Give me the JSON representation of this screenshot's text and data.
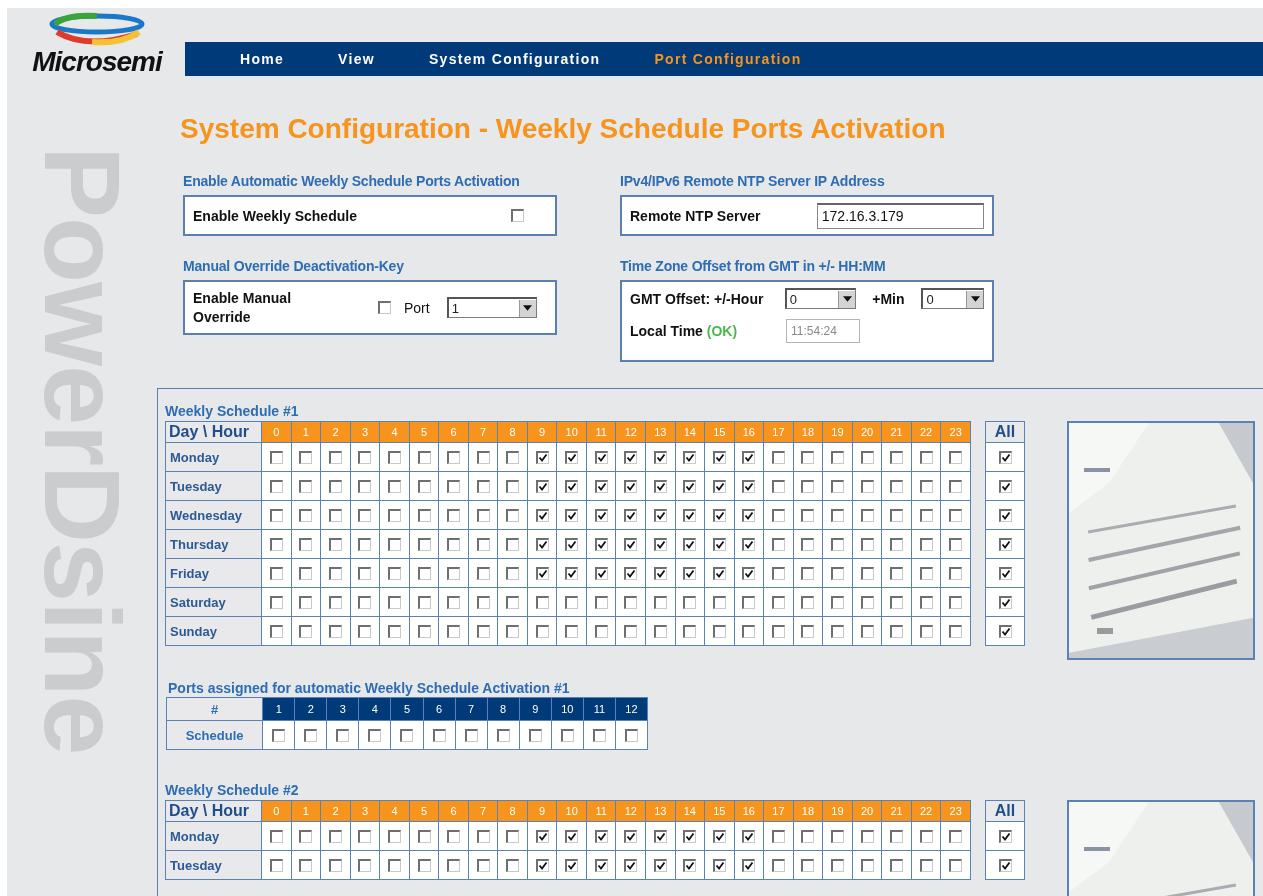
{
  "logo": {
    "text": "Microsemi"
  },
  "nav": [
    {
      "label": "Home",
      "selected": false
    },
    {
      "label": "View",
      "selected": false
    },
    {
      "label": "System Configuration",
      "selected": false
    },
    {
      "label": "Port Configuration",
      "selected": true
    }
  ],
  "side_brand": "PowerDsine",
  "title": "System Configuration - Weekly Schedule Ports Activation",
  "weekly_enable": {
    "heading": "Enable Automatic Weekly Schedule Ports Activation",
    "label": "Enable Weekly Schedule",
    "checked": false
  },
  "manual_override": {
    "heading": "Manual Override Deactivation-Key",
    "label": "Enable Manual Override",
    "checked": false,
    "port_label": "Port",
    "port_value": "1"
  },
  "ntp": {
    "heading": "IPv4/IPv6 Remote NTP Server IP Address",
    "label": "Remote NTP Server",
    "value": "172.16.3.179"
  },
  "timezone": {
    "heading": "Time Zone Offset from GMT in +/- HH:MM",
    "hour_label": "GMT Offset: +/-Hour",
    "hour_value": "0",
    "min_label": "+Min",
    "min_value": "0",
    "local_time_label": "Local Time",
    "status": "(OK)",
    "local_time": "11:54:24",
    "local_time_disabled": true
  },
  "schedules": [
    {
      "title": "Weekly Schedule #1",
      "corner": "Day \\ Hour",
      "hours": [
        "0",
        "1",
        "2",
        "3",
        "4",
        "5",
        "6",
        "7",
        "8",
        "9",
        "10",
        "11",
        "12",
        "13",
        "14",
        "15",
        "16",
        "17",
        "18",
        "19",
        "20",
        "21",
        "22",
        "23"
      ],
      "all_label": "All",
      "rows": [
        {
          "day": "Monday",
          "checked": [
            false,
            false,
            false,
            false,
            false,
            false,
            false,
            false,
            false,
            true,
            true,
            true,
            true,
            true,
            true,
            true,
            true,
            false,
            false,
            false,
            false,
            false,
            false,
            false
          ],
          "all": true
        },
        {
          "day": "Tuesday",
          "checked": [
            false,
            false,
            false,
            false,
            false,
            false,
            false,
            false,
            false,
            true,
            true,
            true,
            true,
            true,
            true,
            true,
            true,
            false,
            false,
            false,
            false,
            false,
            false,
            false
          ],
          "all": true
        },
        {
          "day": "Wednesday",
          "checked": [
            false,
            false,
            false,
            false,
            false,
            false,
            false,
            false,
            false,
            true,
            true,
            true,
            true,
            true,
            true,
            true,
            true,
            false,
            false,
            false,
            false,
            false,
            false,
            false
          ],
          "all": true
        },
        {
          "day": "Thursday",
          "checked": [
            false,
            false,
            false,
            false,
            false,
            false,
            false,
            false,
            false,
            true,
            true,
            true,
            true,
            true,
            true,
            true,
            true,
            false,
            false,
            false,
            false,
            false,
            false,
            false
          ],
          "all": true
        },
        {
          "day": "Friday",
          "checked": [
            false,
            false,
            false,
            false,
            false,
            false,
            false,
            false,
            false,
            true,
            true,
            true,
            true,
            true,
            true,
            true,
            true,
            false,
            false,
            false,
            false,
            false,
            false,
            false
          ],
          "all": true
        },
        {
          "day": "Saturday",
          "checked": [
            false,
            false,
            false,
            false,
            false,
            false,
            false,
            false,
            false,
            false,
            false,
            false,
            false,
            false,
            false,
            false,
            false,
            false,
            false,
            false,
            false,
            false,
            false,
            false
          ],
          "all": true
        },
        {
          "day": "Sunday",
          "checked": [
            false,
            false,
            false,
            false,
            false,
            false,
            false,
            false,
            false,
            false,
            false,
            false,
            false,
            false,
            false,
            false,
            false,
            false,
            false,
            false,
            false,
            false,
            false,
            false
          ],
          "all": true
        }
      ],
      "ports": {
        "title": "Ports assigned for automatic Weekly Schedule Activation #1",
        "corner": "#",
        "row_label": "Schedule",
        "numbers": [
          "1",
          "2",
          "3",
          "4",
          "5",
          "6",
          "7",
          "8",
          "9",
          "10",
          "11",
          "12"
        ],
        "checked": [
          false,
          false,
          false,
          false,
          false,
          false,
          false,
          false,
          false,
          false,
          false,
          false
        ]
      }
    },
    {
      "title": "Weekly Schedule #2",
      "corner": "Day \\ Hour",
      "hours": [
        "0",
        "1",
        "2",
        "3",
        "4",
        "5",
        "6",
        "7",
        "8",
        "9",
        "10",
        "11",
        "12",
        "13",
        "14",
        "15",
        "16",
        "17",
        "18",
        "19",
        "20",
        "21",
        "22",
        "23"
      ],
      "all_label": "All",
      "rows": [
        {
          "day": "Monday",
          "checked": [
            false,
            false,
            false,
            false,
            false,
            false,
            false,
            false,
            false,
            true,
            true,
            true,
            true,
            true,
            true,
            true,
            true,
            false,
            false,
            false,
            false,
            false,
            false,
            false
          ],
          "all": true
        },
        {
          "day": "Tuesday",
          "checked": [
            false,
            false,
            false,
            false,
            false,
            false,
            false,
            false,
            false,
            true,
            true,
            true,
            true,
            true,
            true,
            true,
            true,
            false,
            false,
            false,
            false,
            false,
            false,
            false
          ],
          "all": true
        }
      ]
    }
  ]
}
